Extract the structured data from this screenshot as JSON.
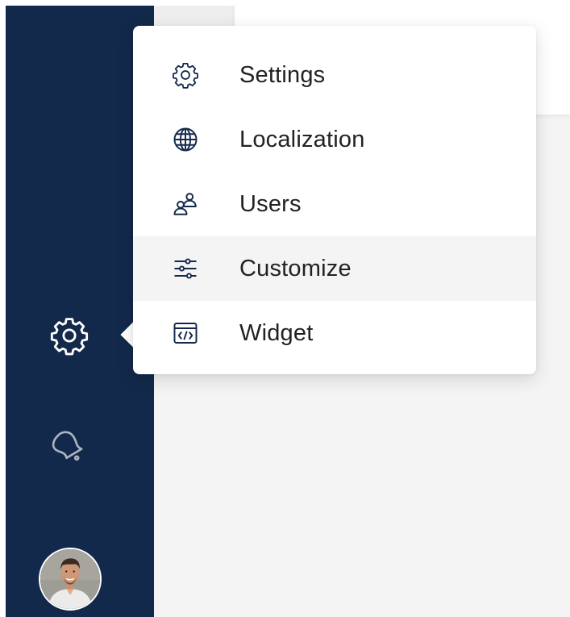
{
  "sidebar": {
    "items": [
      {
        "name": "settings",
        "icon": "gear-icon",
        "active": true
      },
      {
        "name": "notifications",
        "icon": "bell-icon"
      }
    ],
    "avatar": {
      "icon": "user-avatar"
    }
  },
  "dropdown": {
    "items": [
      {
        "label": "Settings",
        "icon": "gear-icon"
      },
      {
        "label": "Localization",
        "icon": "globe-icon"
      },
      {
        "label": "Users",
        "icon": "users-icon"
      },
      {
        "label": "Customize",
        "icon": "sliders-icon",
        "highlighted": true
      },
      {
        "label": "Widget",
        "icon": "code-window-icon"
      }
    ]
  },
  "colors": {
    "sidebar_bg": "#13294b",
    "content_bg": "#f4f4f4",
    "menu_bg": "#ffffff",
    "menu_hover_bg": "#f4f4f4",
    "text": "#222222",
    "icon": "#13294b"
  }
}
